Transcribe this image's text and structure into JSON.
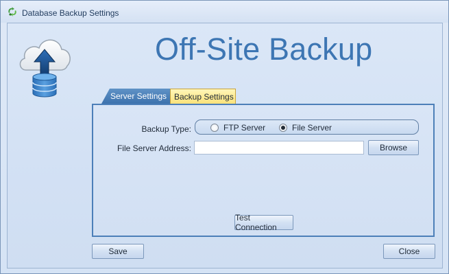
{
  "window": {
    "title": "Database Backup Settings",
    "icon": "recycle-leaf-icon"
  },
  "header": {
    "logo_icon": "cloud-upload-database-icon",
    "heading": "Off-Site Backup"
  },
  "tabs": [
    {
      "label": "Server Settings",
      "active": true,
      "color": "#4a7fba"
    },
    {
      "label": "Backup Settings",
      "active": false,
      "color": "#fbe27a"
    }
  ],
  "server_settings": {
    "backup_type_label": "Backup Type:",
    "backup_type_options": [
      {
        "label": "FTP Server",
        "checked": false
      },
      {
        "label": "File Server",
        "checked": true
      }
    ],
    "file_server_address_label": "File Server Address:",
    "file_server_address_value": "",
    "browse_label": "Browse",
    "test_connection_label": "Test Connection"
  },
  "footer": {
    "save_label": "Save",
    "close_label": "Close"
  },
  "colors": {
    "accent": "#3d76b3",
    "panel_border": "#4c7fb8",
    "background": "#d5e3f5"
  }
}
